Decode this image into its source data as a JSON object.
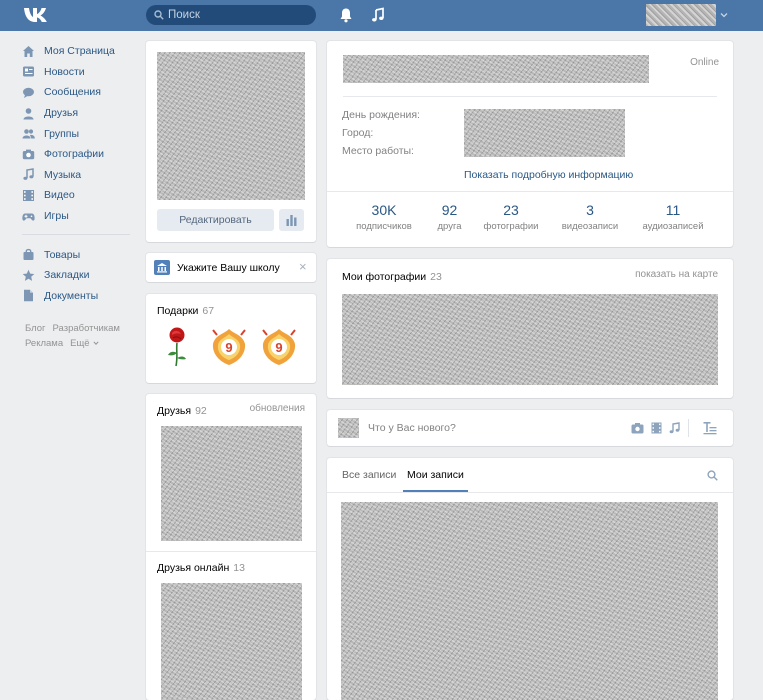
{
  "header": {
    "logo": "vk-logo",
    "search": {
      "placeholder": "Поиск"
    },
    "icons": [
      "bell-icon",
      "music-note-icon"
    ],
    "brand_color": "#4a76a8"
  },
  "menu": {
    "primary": [
      {
        "label": "Моя Страница",
        "icon": "home-icon"
      },
      {
        "label": "Новости",
        "icon": "news-icon"
      },
      {
        "label": "Сообщения",
        "icon": "chat-icon"
      },
      {
        "label": "Друзья",
        "icon": "person-icon"
      },
      {
        "label": "Группы",
        "icon": "group-icon"
      },
      {
        "label": "Фотографии",
        "icon": "camera-icon"
      },
      {
        "label": "Музыка",
        "icon": "music-icon"
      },
      {
        "label": "Видео",
        "icon": "film-icon"
      },
      {
        "label": "Игры",
        "icon": "gamepad-icon"
      }
    ],
    "secondary": [
      {
        "label": "Товары",
        "icon": "bag-icon"
      },
      {
        "label": "Закладки",
        "icon": "star-icon"
      },
      {
        "label": "Документы",
        "icon": "document-icon"
      }
    ]
  },
  "footer": {
    "row1": [
      "Блог",
      "Разработчикам"
    ],
    "row2": [
      "Реклама",
      "Ещё"
    ]
  },
  "profile": {
    "edit_label": "Редактировать",
    "online": "Online",
    "info": {
      "birthday_label": "День рождения:",
      "city_label": "Город:",
      "work_label": "Место работы:",
      "more_label": "Показать подробную информацию"
    },
    "stats": [
      {
        "value": "30K",
        "label": "подписчиков"
      },
      {
        "value": "92",
        "label": "друга"
      },
      {
        "value": "23",
        "label": "фотографии"
      },
      {
        "value": "3",
        "label": "видеозаписи"
      },
      {
        "value": "11",
        "label": "аудиозаписей"
      }
    ]
  },
  "school_prompt": {
    "label": "Укажите Вашу школу",
    "close": "×"
  },
  "gifts": {
    "title": "Подарки",
    "count": "67"
  },
  "friends": {
    "title": "Друзья",
    "count": "92",
    "updates_label": "обновления"
  },
  "friends_online": {
    "title": "Друзья онлайн",
    "count": "13"
  },
  "photos": {
    "title": "Мои фотографии",
    "count": "23",
    "map_label": "показать на карте"
  },
  "composer": {
    "placeholder": "Что у Вас нового?"
  },
  "wall": {
    "tabs": [
      "Все записи",
      "Мои записи"
    ],
    "active_tab": 1
  }
}
